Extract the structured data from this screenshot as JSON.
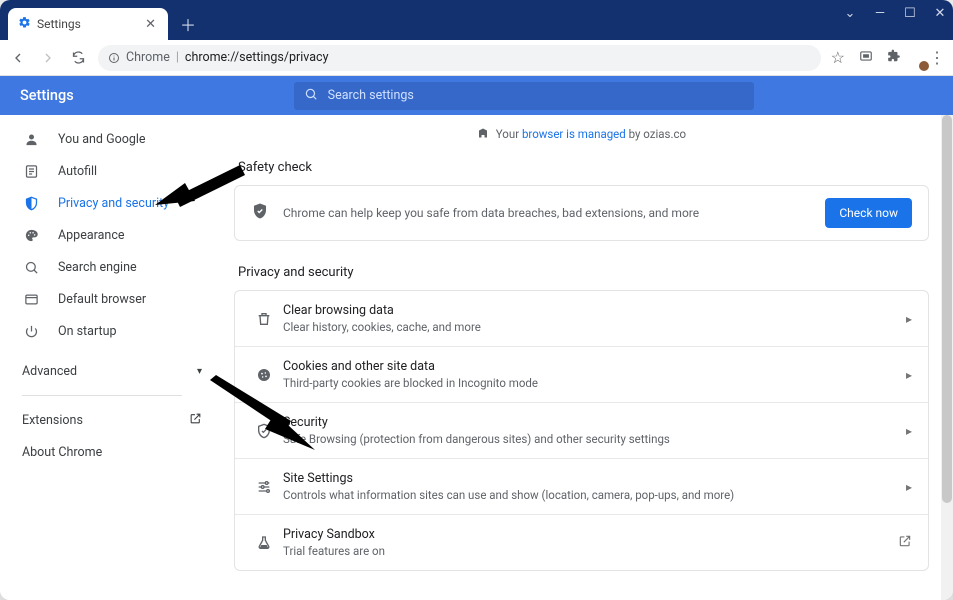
{
  "tab": {
    "title": "Settings"
  },
  "address": {
    "protocol_label": "Chrome",
    "url": "chrome://settings/privacy"
  },
  "header": {
    "title": "Settings",
    "search_placeholder": "Search settings"
  },
  "managed_notice": {
    "prefix": "Your ",
    "link": "browser is managed",
    "suffix": " by ozias.co"
  },
  "sidebar": {
    "items": [
      {
        "label": "You and Google",
        "icon": "person-icon"
      },
      {
        "label": "Autofill",
        "icon": "autofill-icon"
      },
      {
        "label": "Privacy and security",
        "icon": "shield-icon",
        "active": true
      },
      {
        "label": "Appearance",
        "icon": "palette-icon"
      },
      {
        "label": "Search engine",
        "icon": "magnify-icon"
      },
      {
        "label": "Default browser",
        "icon": "window-icon"
      },
      {
        "label": "On startup",
        "icon": "power-icon"
      }
    ],
    "advanced_label": "Advanced",
    "extensions_label": "Extensions",
    "about_label": "About Chrome"
  },
  "safety": {
    "section_title": "Safety check",
    "card_text": "Chrome can help keep you safe from data breaches, bad extensions, and more",
    "button_label": "Check now"
  },
  "privacy": {
    "section_title": "Privacy and security",
    "rows": [
      {
        "title": "Clear browsing data",
        "sub": "Clear history, cookies, cache, and more",
        "icon": "trash-icon",
        "tail": "chevron"
      },
      {
        "title": "Cookies and other site data",
        "sub": "Third-party cookies are blocked in Incognito mode",
        "icon": "cookie-icon",
        "tail": "chevron"
      },
      {
        "title": "Security",
        "sub": "Safe Browsing (protection from dangerous sites) and other security settings",
        "icon": "shield-check-icon",
        "tail": "chevron"
      },
      {
        "title": "Site Settings",
        "sub": "Controls what information sites can use and show (location, camera, pop-ups, and more)",
        "icon": "tune-icon",
        "tail": "chevron"
      },
      {
        "title": "Privacy Sandbox",
        "sub": "Trial features are on",
        "icon": "flask-icon",
        "tail": "external"
      }
    ]
  }
}
